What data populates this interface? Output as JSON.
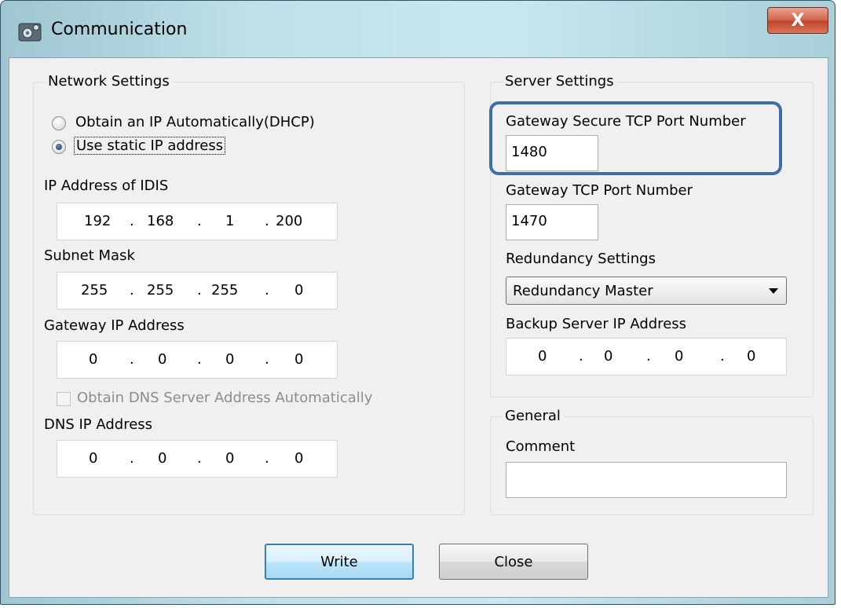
{
  "window": {
    "title": "Communication",
    "close_label": "X"
  },
  "network": {
    "legend": "Network Settings",
    "dhcp_label": "Obtain an IP Automatically(DHCP)",
    "static_label": "Use static IP address",
    "ip_label": "IP Address of IDIS",
    "ip": [
      "192",
      "168",
      "1",
      "200"
    ],
    "subnet_label": "Subnet Mask",
    "subnet": [
      "255",
      "255",
      "255",
      "0"
    ],
    "gateway_label": "Gateway IP Address",
    "gateway": [
      "0",
      "0",
      "0",
      "0"
    ],
    "dns_auto_label": "Obtain DNS Server Address Automatically",
    "dns_label": "DNS IP Address",
    "dns": [
      "0",
      "0",
      "0",
      "0"
    ]
  },
  "server": {
    "legend": "Server Settings",
    "secure_port_label": "Gateway Secure TCP Port Number",
    "secure_port": "1480",
    "tcp_port_label": "Gateway TCP Port Number",
    "tcp_port": "1470",
    "redundancy_label": "Redundancy Settings",
    "redundancy_value": "Redundancy Master",
    "backup_label": "Backup Server IP Address",
    "backup_ip": [
      "0",
      "0",
      "0",
      "0"
    ]
  },
  "general": {
    "legend": "General",
    "comment_label": "Comment",
    "comment_value": ""
  },
  "buttons": {
    "write": "Write",
    "close": "Close"
  }
}
